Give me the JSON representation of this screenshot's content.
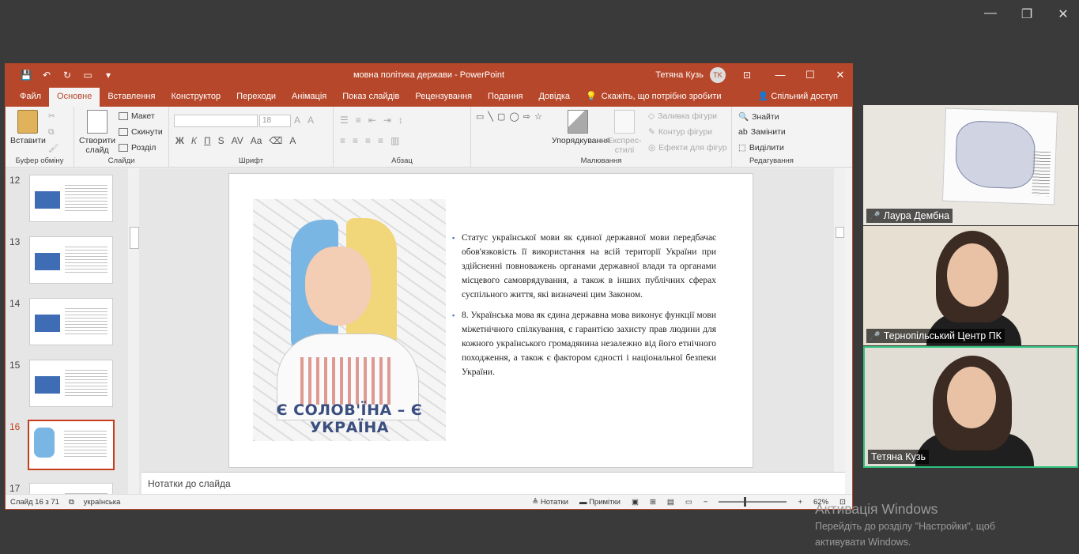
{
  "outer_window": {
    "min": "—",
    "restore": "❐",
    "close": "✕"
  },
  "ppt": {
    "title": "мовна політика держави  -  PowerPoint",
    "user_name": "Тетяна Кузь",
    "user_initials": "TK",
    "qat": {
      "save": "💾",
      "undo": "↶",
      "redo": "↻",
      "present": "▭",
      "more": "▾"
    },
    "win": {
      "ribbon_opts": "⊡",
      "min": "—",
      "max": "☐",
      "close": "✕"
    },
    "tabs": [
      "Файл",
      "Основне",
      "Вставлення",
      "Конструктор",
      "Переходи",
      "Анімація",
      "Показ слайдів",
      "Рецензування",
      "Подання",
      "Довідка"
    ],
    "tell_me": "Скажіть, що потрібно зробити",
    "share": "Спільний доступ",
    "ribbon": {
      "paste": "Вставити",
      "clipboard": "Буфер обміну",
      "new_slide": "Створити слайд",
      "layout": "Макет",
      "reset": "Скинути",
      "section": "Розділ",
      "slides": "Слайди",
      "font_size": "18",
      "font": "Шрифт",
      "paragraph": "Абзац",
      "arrange": "Упорядкування",
      "quick_styles": "Експрес-стилі",
      "shape_fill": "Заливка фігури",
      "shape_outline": "Контур фігури",
      "shape_effects": "Ефекти для фігур",
      "drawing": "Малювання",
      "find": "Знайти",
      "replace": "Замінити",
      "select": "Виділити",
      "editing": "Редагування"
    },
    "thumbs": [
      {
        "num": "12"
      },
      {
        "num": "13"
      },
      {
        "num": "14"
      },
      {
        "num": "15"
      },
      {
        "num": "16"
      },
      {
        "num": "17"
      }
    ],
    "slide": {
      "banner": "Є СОЛОВ'ЇНА – Є УКРАЇНА",
      "bullets": [
        "Статус української мови як єдиної державної мови передбачає обов'язковість її використання на всій території України при здійсненні повноважень органами державної влади та органами місцевого самоврядування, а також в інших публічних сферах суспільного життя, які визначені цим Законом.",
        "8. Українська мова як єдина державна мова виконує функції мови міжетнічного спілкування, є гарантією захисту прав людини для кожного українського громадянина незалежно від його етнічного походження, а також є фактором єдності і національної безпеки України."
      ]
    },
    "notes_placeholder": "Нотатки до слайда",
    "status": {
      "slide_counter": "Слайд 16 з 71",
      "language": "українська",
      "notes": "Нотатки",
      "comments": "Примітки",
      "zoom": "62%"
    }
  },
  "participants": [
    {
      "name": "Лаура Дембна",
      "muted": true
    },
    {
      "name": "Тернопільський Центр ПК",
      "muted": true
    },
    {
      "name": "Тетяна Кузь",
      "muted": false
    }
  ],
  "activation": {
    "title": "Активація Windows",
    "line1": "Перейдіть до розділу \"Настройки\", щоб",
    "line2": "активувати Windows."
  }
}
